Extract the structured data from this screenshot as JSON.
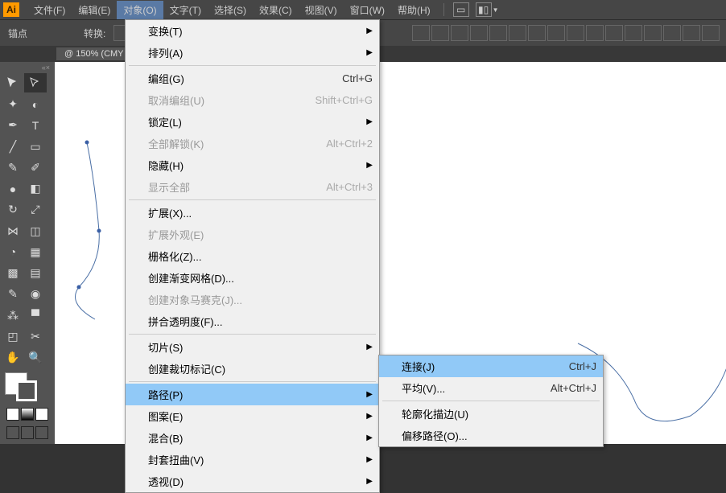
{
  "menubar": {
    "items": [
      "文件(F)",
      "编辑(E)",
      "对象(O)",
      "文字(T)",
      "选择(S)",
      "效果(C)",
      "视图(V)",
      "窗口(W)",
      "帮助(H)"
    ],
    "activeIndex": 2
  },
  "controlbar": {
    "anchor": "锚点",
    "convert": "转换:"
  },
  "doc": {
    "tab": "@ 150% (CMY"
  },
  "dropdown1": [
    {
      "label": "变换(T)",
      "arrow": true
    },
    {
      "label": "排列(A)",
      "arrow": true
    },
    {
      "sep": true
    },
    {
      "label": "编组(G)",
      "shortcut": "Ctrl+G"
    },
    {
      "label": "取消编组(U)",
      "shortcut": "Shift+Ctrl+G",
      "disabled": true
    },
    {
      "label": "锁定(L)",
      "arrow": true
    },
    {
      "label": "全部解锁(K)",
      "shortcut": "Alt+Ctrl+2",
      "disabled": true
    },
    {
      "label": "隐藏(H)",
      "arrow": true
    },
    {
      "label": "显示全部",
      "shortcut": "Alt+Ctrl+3",
      "disabled": true
    },
    {
      "sep": true
    },
    {
      "label": "扩展(X)..."
    },
    {
      "label": "扩展外观(E)",
      "disabled": true
    },
    {
      "label": "栅格化(Z)..."
    },
    {
      "label": "创建渐变网格(D)..."
    },
    {
      "label": "创建对象马赛克(J)...",
      "disabled": true
    },
    {
      "label": "拼合透明度(F)..."
    },
    {
      "sep": true
    },
    {
      "label": "切片(S)",
      "arrow": true
    },
    {
      "label": "创建裁切标记(C)"
    },
    {
      "sep": true
    },
    {
      "label": "路径(P)",
      "arrow": true,
      "highlight": true
    },
    {
      "label": "图案(E)",
      "arrow": true
    },
    {
      "label": "混合(B)",
      "arrow": true
    },
    {
      "label": "封套扭曲(V)",
      "arrow": true
    },
    {
      "label": "透视(D)",
      "arrow": true
    }
  ],
  "dropdown2": [
    {
      "label": "连接(J)",
      "shortcut": "Ctrl+J",
      "highlight": true
    },
    {
      "label": "平均(V)...",
      "shortcut": "Alt+Ctrl+J"
    },
    {
      "sep": true
    },
    {
      "label": "轮廓化描边(U)"
    },
    {
      "label": "偏移路径(O)..."
    }
  ]
}
